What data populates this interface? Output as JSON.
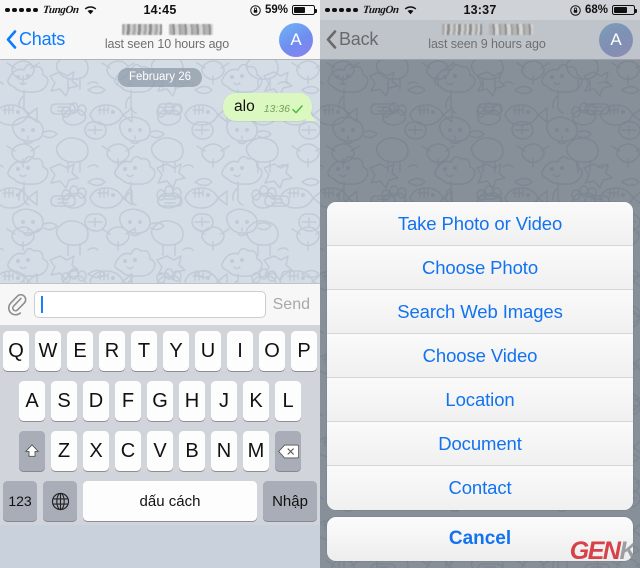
{
  "left": {
    "status": {
      "signal_dots": 5,
      "carrier": "TungOn",
      "wifi_icon": "wifi-icon",
      "time": "14:45",
      "lock_icon": "rotation-lock-icon",
      "battery_pct": "59%",
      "battery_level": 59
    },
    "nav": {
      "back_label": "Chats",
      "back_icon": "chevron-left-icon",
      "title_redacted": true,
      "subtitle": "last seen 10 hours ago",
      "avatar_initial": "A"
    },
    "chat": {
      "date_chip": "February 26",
      "messages": [
        {
          "text": "alo",
          "time": "13:36",
          "status_icon": "single-check-icon",
          "outgoing": true
        }
      ]
    },
    "input": {
      "attach_icon": "paperclip-icon",
      "value": "",
      "placeholder": "",
      "send_label": "Send"
    },
    "keyboard": {
      "row1": [
        "Q",
        "W",
        "E",
        "R",
        "T",
        "Y",
        "U",
        "I",
        "O",
        "P"
      ],
      "row2": [
        "A",
        "S",
        "D",
        "F",
        "G",
        "H",
        "J",
        "K",
        "L"
      ],
      "row3": [
        "Z",
        "X",
        "C",
        "V",
        "B",
        "N",
        "M"
      ],
      "shift_icon": "shift-arrow-icon",
      "delete_icon": "backspace-icon",
      "numeric_label": "123",
      "globe_icon": "globe-icon",
      "space_label": "dấu cách",
      "enter_label": "Nhập"
    }
  },
  "right": {
    "status": {
      "signal_dots": 5,
      "carrier": "TungOn",
      "wifi_icon": "wifi-icon",
      "time": "13:37",
      "lock_icon": "rotation-lock-icon",
      "battery_pct": "68%",
      "battery_level": 68
    },
    "nav": {
      "back_label": "Back",
      "back_icon": "chevron-left-icon",
      "title_redacted": true,
      "subtitle": "last seen 9 hours ago",
      "avatar_initial": "A"
    },
    "action_sheet": {
      "options": [
        "Take Photo or Video",
        "Choose Photo",
        "Search Web Images",
        "Choose Video",
        "Location",
        "Document",
        "Contact"
      ],
      "cancel_label": "Cancel"
    }
  },
  "watermark": {
    "part1": "GEN",
    "part2": "K"
  },
  "colors": {
    "accent_blue": "#0a7cff",
    "sheet_blue": "#1273f0",
    "bubble_green": "#dcf8c1",
    "chat_bg": "#d4dce5"
  }
}
